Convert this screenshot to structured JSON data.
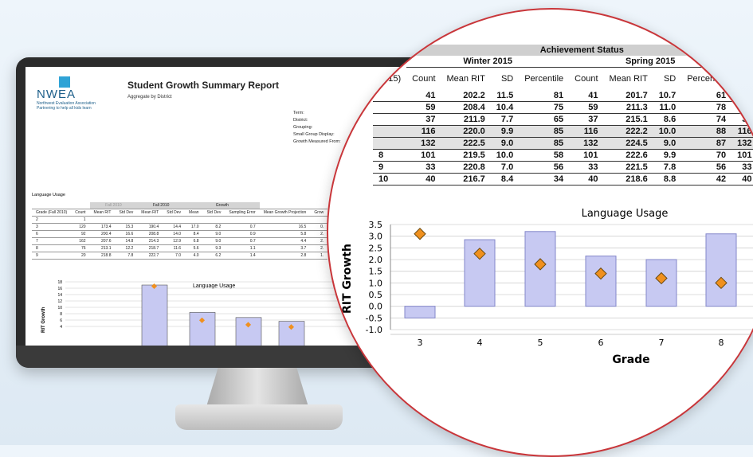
{
  "report": {
    "logo_text": "NWEA",
    "logo_subtitle": "Northwest Evaluation Association",
    "logo_tagline": "Partnering to help all kids learn",
    "title": "Student Growth Summary Report",
    "subtitle": "Aggregate by District",
    "meta_labels": [
      "Term:",
      "District:",
      "Grouping:",
      "Small Group Display:",
      "Growth Measured From:"
    ]
  },
  "small_table": {
    "section_title": "Language Usage",
    "group_headers": [
      "Fall 2010",
      "Fall 2010",
      "Growth"
    ],
    "columns": [
      "Grade (Fall 2010)",
      "Count",
      "Mean RIT",
      "Std Dev",
      "Mean RIT",
      "Std Dev",
      "Mean",
      "Std Dev",
      "Sampling Error",
      "Mean Growth Projection",
      "Grow"
    ],
    "rows": [
      [
        "2",
        "1",
        "",
        "",
        "",
        "",
        "",
        "",
        "",
        "",
        ""
      ],
      [
        "3",
        "120",
        "173.4",
        "15.3",
        "190.4",
        "14.4",
        "17.0",
        "8.2",
        "0.7",
        "16.5",
        "0."
      ],
      [
        "6",
        "92",
        "200.4",
        "16.6",
        "208.8",
        "14.0",
        "8.4",
        "9.0",
        "0.9",
        "5.8",
        "2."
      ],
      [
        "7",
        "162",
        "207.6",
        "14.8",
        "214.3",
        "12.9",
        "6.8",
        "9.0",
        "0.7",
        "4.4",
        "2."
      ],
      [
        "8",
        "76",
        "213.1",
        "12.2",
        "218.7",
        "11.6",
        "5.6",
        "9.3",
        "1.1",
        "3.7",
        "2."
      ],
      [
        "9",
        "20",
        "218.8",
        "7.8",
        "222.7",
        "7.0",
        "4.0",
        "6.2",
        "1.4",
        "2.8",
        "1."
      ]
    ]
  },
  "small_chart": {
    "title": "Language Usage",
    "ylabel": "RIT Growth",
    "ticks": [
      "18",
      "16",
      "14",
      "12",
      "10",
      "8",
      "6",
      "4"
    ]
  },
  "big_table": {
    "header": "Achievement Status",
    "seasons": [
      "Winter 2015",
      "Spring 2015"
    ],
    "first_col_header": "2015)",
    "columns": [
      "Count",
      "Mean RIT",
      "SD",
      "Percentile",
      "Count",
      "Mean RIT",
      "SD",
      "Percentile",
      "C"
    ],
    "rows": [
      [
        "",
        "41",
        "202.2",
        "11.5",
        "81",
        "41",
        "201.7",
        "10.7",
        "61",
        "4"
      ],
      [
        "",
        "59",
        "208.4",
        "10.4",
        "75",
        "59",
        "211.3",
        "11.0",
        "78",
        "59"
      ],
      [
        "",
        "37",
        "211.9",
        "7.7",
        "65",
        "37",
        "215.1",
        "8.6",
        "74",
        "37"
      ],
      [
        "",
        "116",
        "220.0",
        "9.9",
        "85",
        "116",
        "222.2",
        "10.0",
        "88",
        "116"
      ],
      [
        "",
        "132",
        "222.5",
        "9.0",
        "85",
        "132",
        "224.5",
        "9.0",
        "87",
        "132"
      ],
      [
        "8",
        "101",
        "219.5",
        "10.0",
        "58",
        "101",
        "222.6",
        "9.9",
        "70",
        "101"
      ],
      [
        "9",
        "33",
        "220.8",
        "7.0",
        "56",
        "33",
        "221.5",
        "7.8",
        "56",
        "33"
      ],
      [
        "10",
        "40",
        "216.7",
        "8.4",
        "34",
        "40",
        "218.6",
        "8.8",
        "42",
        "40"
      ]
    ]
  },
  "chart_data": {
    "type": "bar",
    "title": "Language Usage",
    "xlabel": "Grade",
    "ylabel": "RIT Growth",
    "categories": [
      "3",
      "4",
      "5",
      "6",
      "7",
      "8"
    ],
    "ylim": [
      -1.0,
      3.5
    ],
    "yticks": [
      "3.5",
      "3.0",
      "2.5",
      "2.0",
      "1.5",
      "1.0",
      "0.5",
      "0.0",
      "-0.5",
      "-1.0"
    ],
    "series": [
      {
        "values": [
          -0.5,
          2.85,
          3.2,
          2.15,
          2.0,
          3.1
        ]
      },
      {
        "values": [
          3.1,
          2.25,
          1.8,
          1.4,
          1.2,
          1.0
        ]
      }
    ],
    "colors": {
      "bar": "#c7c9f2",
      "bar_border": "#8387c9",
      "marker": "#f0901e",
      "grid": "#d0d0d0"
    },
    "grid": true
  }
}
